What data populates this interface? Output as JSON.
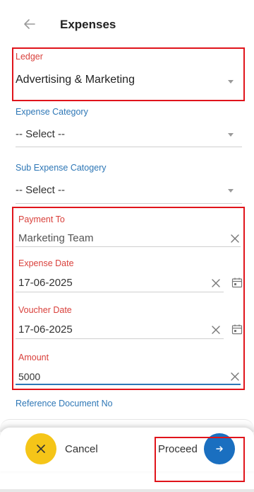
{
  "header": {
    "title": "Expenses"
  },
  "form": {
    "ledger": {
      "label": "Ledger",
      "value": "Advertising & Marketing"
    },
    "expense_category": {
      "label": "Expense Category",
      "value": "-- Select --"
    },
    "sub_expense_category": {
      "label": "Sub Expense Catogery",
      "value": "-- Select --"
    },
    "payment_to": {
      "label": "Payment To",
      "value": "Marketing Team"
    },
    "expense_date": {
      "label": "Expense Date",
      "value": "17-06-2025"
    },
    "voucher_date": {
      "label": "Voucher Date",
      "value": "17-06-2025"
    },
    "amount": {
      "label": "Amount",
      "value": "5000"
    },
    "reference_document": {
      "label": "Reference Document No"
    }
  },
  "footer": {
    "cancel_label": "Cancel",
    "proceed_label": "Proceed"
  },
  "colors": {
    "accent_blue": "#1a6fc0",
    "label_blue": "#2e77b6",
    "error_red": "#d9403b",
    "cancel_yellow": "#f5c518",
    "highlight_red": "#e0141b"
  }
}
